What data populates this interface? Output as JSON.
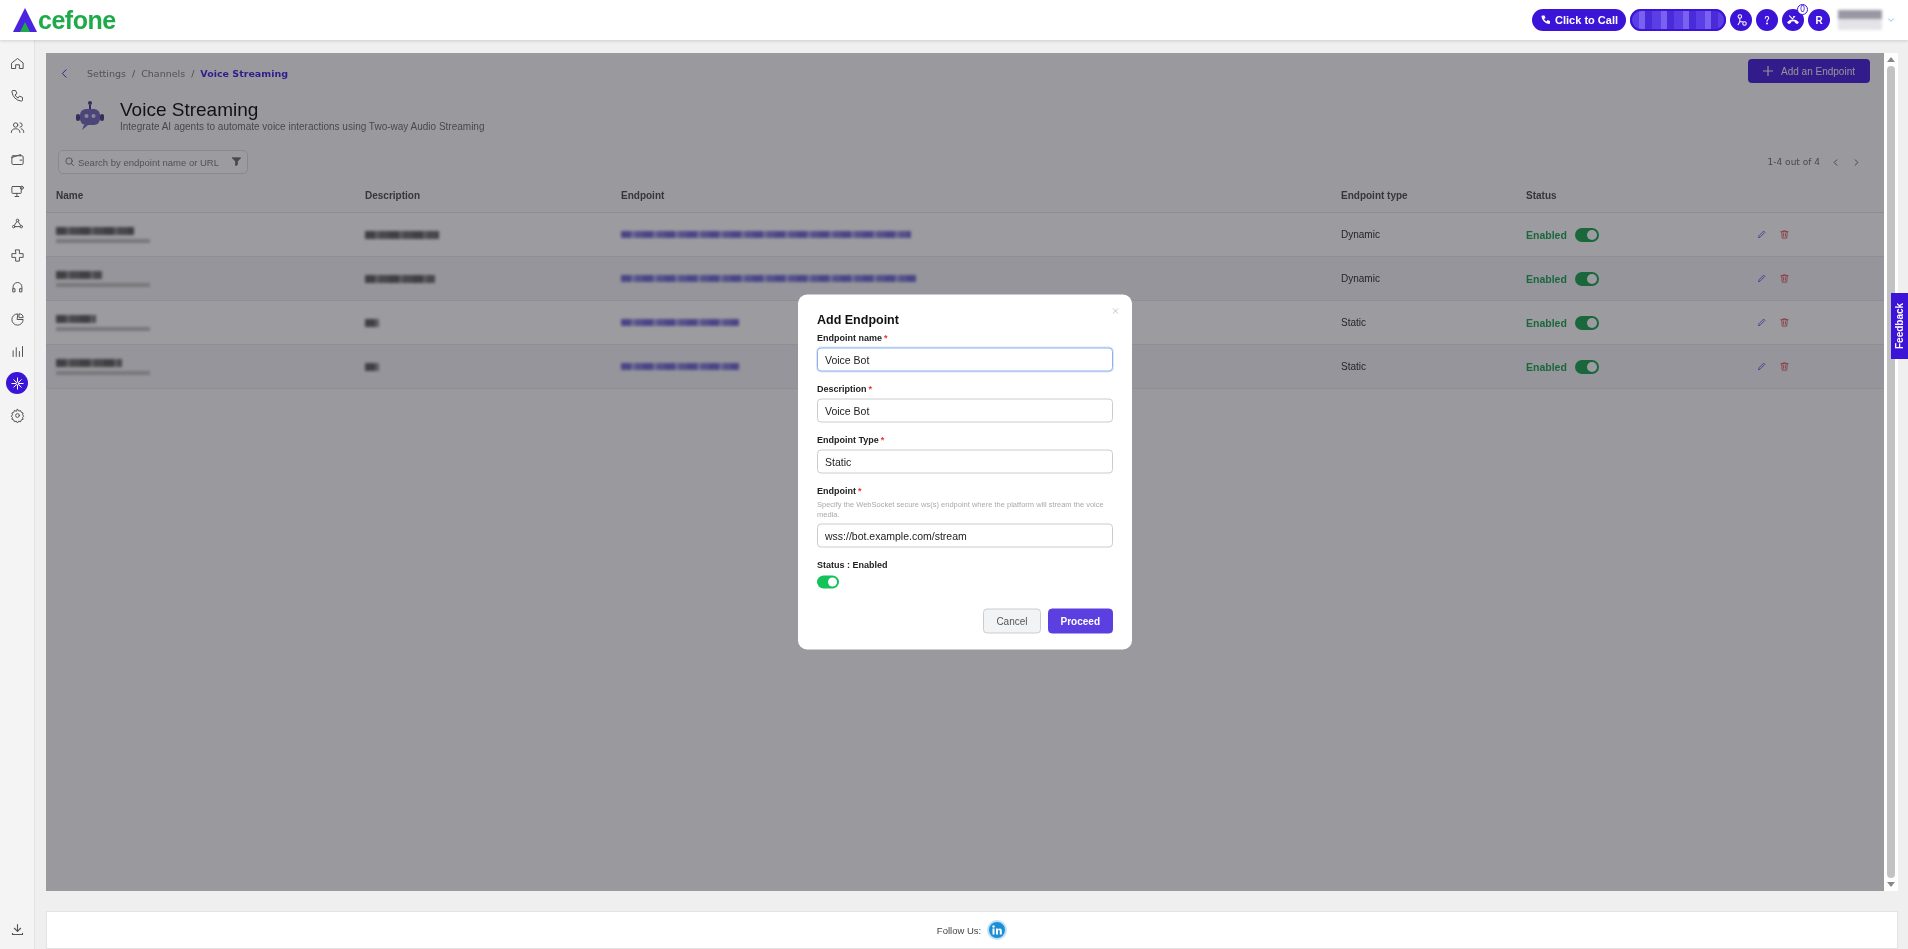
{
  "topbar": {
    "logo_text": "cefone",
    "call_button": "Click to Call",
    "missed_calls_badge": "0",
    "avatar_initial": "R"
  },
  "sidebar": {
    "items": [
      {
        "selected": false
      },
      {
        "selected": false
      },
      {
        "selected": false
      },
      {
        "selected": false
      },
      {
        "selected": false
      },
      {
        "selected": false
      },
      {
        "selected": false
      },
      {
        "selected": false
      },
      {
        "selected": false
      },
      {
        "selected": false
      },
      {
        "selected": true
      },
      {
        "selected": false
      }
    ]
  },
  "breadcrumb": {
    "separator": "/",
    "items": [
      {
        "label": "Settings",
        "current": false
      },
      {
        "label": "Channels",
        "current": false
      },
      {
        "label": "Voice Streaming",
        "current": true
      }
    ]
  },
  "add_button": "Add an Endpoint",
  "header": {
    "title": "Voice Streaming",
    "subtitle": "Integrate AI agents to automate voice interactions using Two-way Audio Streaming"
  },
  "search": {
    "placeholder": "Search by endpoint name or URL"
  },
  "pagination": {
    "range": "1-4 out of 4"
  },
  "table": {
    "columns": [
      "Name",
      "Description",
      "Endpoint",
      "Endpoint type",
      "Status"
    ],
    "rows": [
      {
        "endpoint_type": "Dynamic",
        "status": "Enabled",
        "enabled": true
      },
      {
        "endpoint_type": "Dynamic",
        "status": "Enabled",
        "enabled": true
      },
      {
        "endpoint_type": "Static",
        "status": "Enabled",
        "enabled": true
      },
      {
        "endpoint_type": "Static",
        "status": "Enabled",
        "enabled": true
      }
    ]
  },
  "modal": {
    "title": "Add Endpoint",
    "fields": [
      {
        "label": "Endpoint name",
        "required_mark": "*",
        "value": "Voice Bot",
        "focused": true
      },
      {
        "label": "Description",
        "required_mark": "*",
        "value": "Voice Bot",
        "focused": false
      },
      {
        "label": "Endpoint Type",
        "required_mark": "*",
        "value": "Static",
        "focused": false
      },
      {
        "label": "Endpoint",
        "required_mark": "*",
        "hint": "Specify the WebSocket secure ws(s) endpoint where the platform will stream the voice media.",
        "value": "wss://bot.example.com/stream",
        "focused": false
      }
    ],
    "status_label": "Status : Enabled",
    "status_on": true,
    "buttons": [
      {
        "label": "Cancel",
        "kind": "secondary"
      },
      {
        "label": "Proceed",
        "kind": "primary"
      }
    ]
  },
  "feedback_tab": "Feedback",
  "footer": {
    "follow_label": "Follow Us:"
  }
}
